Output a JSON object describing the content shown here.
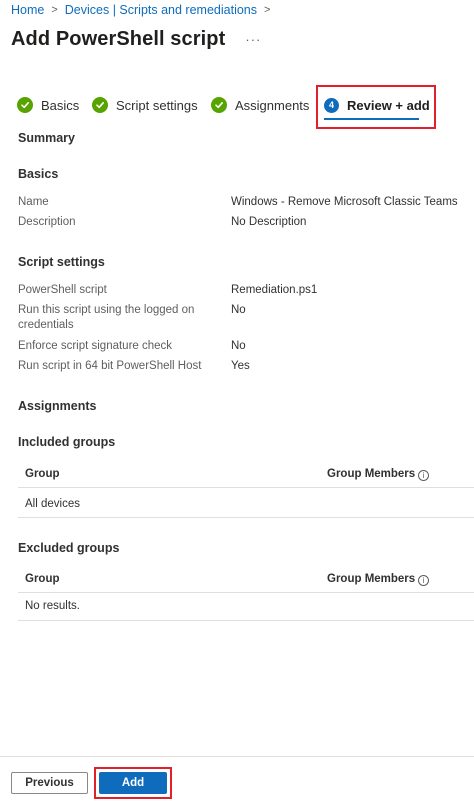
{
  "breadcrumb": {
    "home": "Home",
    "devices": "Devices | Scripts and remediations",
    "separator": ">"
  },
  "header": {
    "title": "Add PowerShell script",
    "more": "···"
  },
  "tabs": [
    {
      "label": "Basics",
      "state": "complete"
    },
    {
      "label": "Script settings",
      "state": "complete"
    },
    {
      "label": "Assignments",
      "state": "complete"
    },
    {
      "label": "Review + add",
      "state": "active",
      "number": "4"
    }
  ],
  "summary": {
    "heading": "Summary",
    "basics": {
      "heading": "Basics",
      "name_label": "Name",
      "name_value": "Windows - Remove Microsoft Classic Teams",
      "description_label": "Description",
      "description_value": "No Description"
    },
    "script_settings": {
      "heading": "Script settings",
      "powershell_label": "PowerShell script",
      "powershell_value": "Remediation.ps1",
      "logged_on_label": "Run this script using the logged on credentials",
      "logged_on_value": "No",
      "signature_label": "Enforce script signature check",
      "signature_value": "No",
      "host64_label": "Run script in 64 bit PowerShell Host",
      "host64_value": "Yes"
    },
    "assignments": {
      "heading": "Assignments",
      "included": {
        "heading": "Included groups",
        "col_group": "Group",
        "col_members": "Group Members",
        "rows": [
          "All devices"
        ]
      },
      "excluded": {
        "heading": "Excluded groups",
        "col_group": "Group",
        "col_members": "Group Members",
        "empty": "No results."
      }
    }
  },
  "footer": {
    "previous_label": "Previous",
    "add_label": "Add"
  },
  "colors": {
    "accent": "#0f6cbd",
    "success": "#57a300",
    "highlight": "#e0202a"
  }
}
